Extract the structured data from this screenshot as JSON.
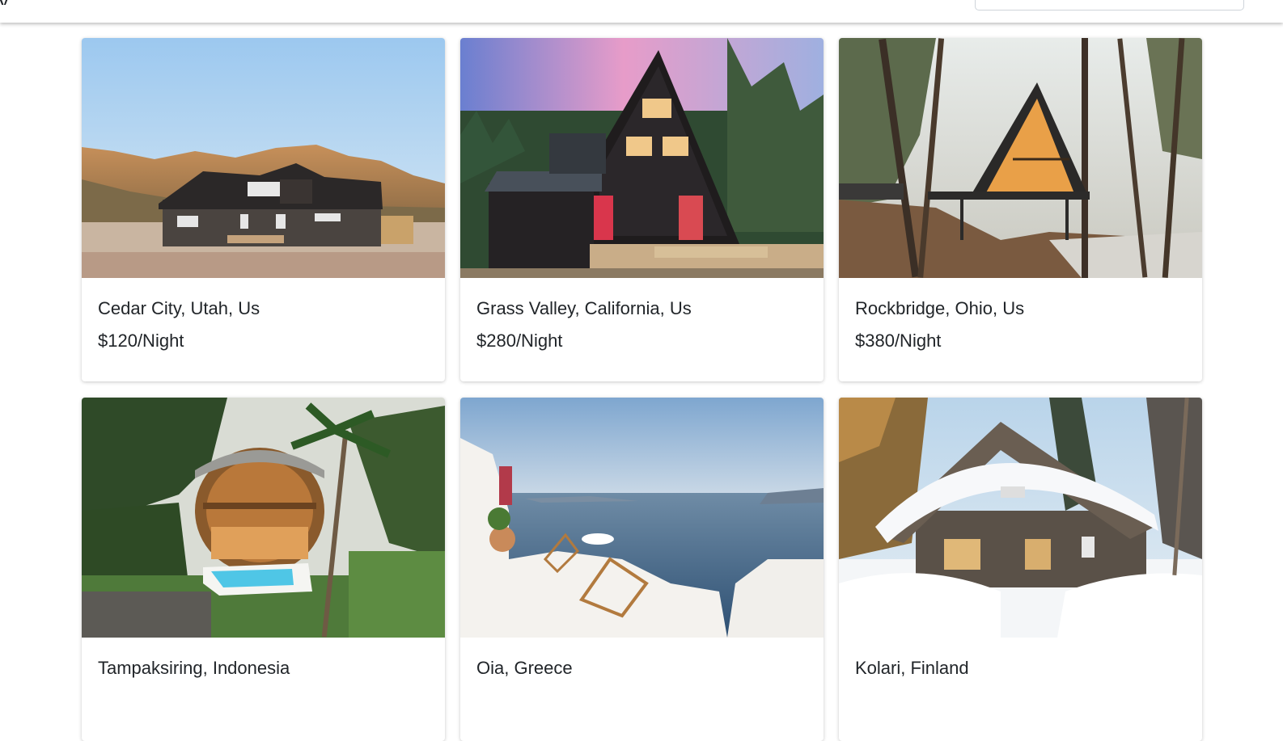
{
  "navbar": {
    "search": {
      "value": "",
      "placeholder": ""
    }
  },
  "listings": [
    {
      "location": "Cedar City, Utah, Us",
      "price": "$120/Night",
      "photo": "desert-dark-house"
    },
    {
      "location": "Grass Valley, California, Us",
      "price": "$280/Night",
      "photo": "black-a-frame-cabin-sunset"
    },
    {
      "location": "Rockbridge, Ohio, Us",
      "price": "$380/Night",
      "photo": "a-frame-forest-cabin"
    },
    {
      "location": "Tampaksiring, Indonesia",
      "price": "",
      "photo": "round-bamboo-villa-pool"
    },
    {
      "location": "Oia, Greece",
      "price": "",
      "photo": "white-terrace-sea-view"
    },
    {
      "location": "Kolari, Finland",
      "price": "",
      "photo": "snowy-log-cabin"
    }
  ],
  "colors": {
    "text": "#212529",
    "card_background": "#ffffff",
    "page_background": "#ffffff"
  }
}
